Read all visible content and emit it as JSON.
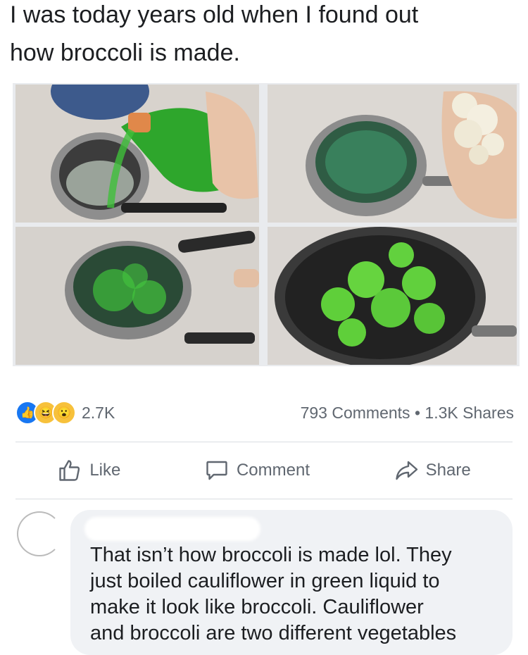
{
  "post": {
    "caption": "I was today years old when I found out\nhow broccoli is made."
  },
  "images": [
    {
      "name": "photo-pouring-green-liquid"
    },
    {
      "name": "photo-green-water-boiling"
    },
    {
      "name": "photo-boiling-with-strainer"
    },
    {
      "name": "photo-green-florets-in-pan"
    }
  ],
  "reactions": {
    "icons": [
      "like-icon",
      "haha-icon",
      "wow-icon"
    ],
    "count": "2.7K",
    "comments": "793 Comments",
    "separator": "•",
    "shares": "1.3K Shares"
  },
  "actions": {
    "like": "Like",
    "comment": "Comment",
    "share": "Share"
  },
  "comment": {
    "text": "That isn’t how broccoli is made lol. They\njust boiled cauliflower in green liquid to\nmake it look like broccoli. Cauliflower\nand broccoli are two different vegetables"
  },
  "colors": {
    "accent": "#1877f2",
    "green": "#3fbf3a"
  }
}
